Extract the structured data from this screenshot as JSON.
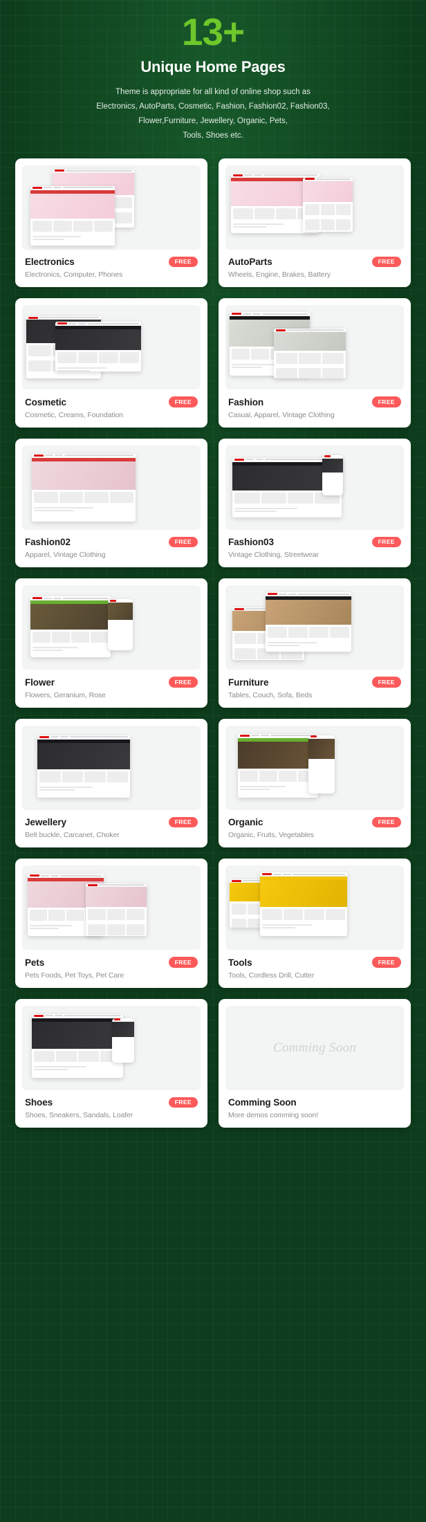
{
  "hero": {
    "count": "13+",
    "title": "Unique Home Pages",
    "subtitle_lines": [
      "Theme is appropriate for all kind of online shop such as",
      "Electronics, AutoParts, Cosmetic, Fashion, Fashion02, Fashion03,",
      "Flower,Furniture, Jewellery, Organic, Pets,",
      "Tools, Shoes etc."
    ]
  },
  "colors": {
    "background": "#0d3d1c",
    "accent_green": "#6ec72b",
    "badge_red": "#fc5a5a",
    "card_white": "#ffffff",
    "title_dark": "#1b1b1b",
    "desc_gray": "#8d8d8d"
  },
  "badge_label": "FREE",
  "demos": [
    {
      "name": "Electronics",
      "desc": "Electronics, Computer, Phones",
      "badge": "FREE",
      "theme": "red",
      "free": true
    },
    {
      "name": "AutoParts",
      "desc": "Wheels, Engine, Brakes, Battery",
      "badge": "FREE",
      "theme": "red",
      "free": true
    },
    {
      "name": "Cosmetic",
      "desc": "Cosmetic, Creams, Foundation",
      "badge": "FREE",
      "theme": "dark",
      "free": true
    },
    {
      "name": "Fashion",
      "desc": "Casual, Apparel, Vintage Clothing",
      "badge": "FREE",
      "theme": "light",
      "free": true
    },
    {
      "name": "Fashion02",
      "desc": "Apparel, Vintage Clothing",
      "badge": "FREE",
      "theme": "pink",
      "free": true
    },
    {
      "name": "Fashion03",
      "desc": "Vintage Clothing, Streetwear",
      "badge": "FREE",
      "theme": "dark",
      "free": true
    },
    {
      "name": "Flower",
      "desc": "Flowers, Geranium, Rose",
      "badge": "FREE",
      "theme": "flower",
      "free": true
    },
    {
      "name": "Furniture",
      "desc": "Tables, Couch, Sofa, Beds",
      "badge": "FREE",
      "theme": "wood",
      "free": true
    },
    {
      "name": "Jewellery",
      "desc": "Belt buckle, Carcanet, Choker",
      "badge": "FREE",
      "theme": "dark",
      "free": true
    },
    {
      "name": "Organic",
      "desc": "Organic, Fruits, Vegetables",
      "badge": "FREE",
      "theme": "green",
      "free": true
    },
    {
      "name": "Pets",
      "desc": "Pets Foods, Pet Toys, Pet Care",
      "badge": "FREE",
      "theme": "pink",
      "free": true
    },
    {
      "name": "Tools",
      "desc": "Tools, Cordless Drill, Cutter",
      "badge": "FREE",
      "theme": "yellow",
      "free": true
    },
    {
      "name": "Shoes",
      "desc": "Shoes, Sneakers, Sandals, Loafer",
      "badge": "FREE",
      "theme": "dark",
      "free": true
    },
    {
      "name": "Comming Soon",
      "desc": "More demos comming soon!",
      "badge": "",
      "theme": "soon",
      "free": false,
      "placeholder_text": "Comming Soon"
    }
  ]
}
